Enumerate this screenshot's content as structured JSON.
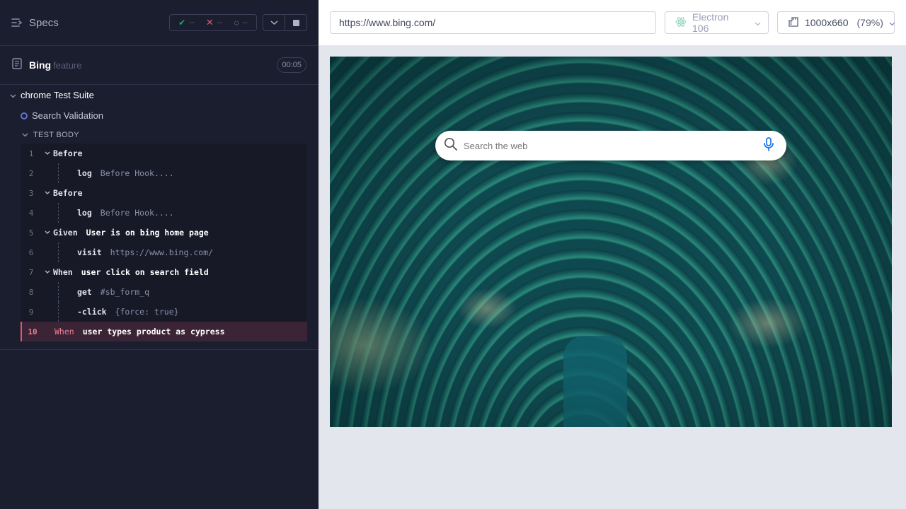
{
  "sidebar": {
    "title": "Specs",
    "stats": {
      "passed": "--",
      "failed": "--",
      "pending": "--"
    },
    "file": {
      "name": "Bing",
      "ext": "feature",
      "duration": "00:05"
    },
    "suite": "chrome Test Suite",
    "test": "Search Validation",
    "body_label": "TEST BODY",
    "commands": [
      {
        "num": "1",
        "kw": "Before",
        "msg": "",
        "arg": ""
      },
      {
        "num": "2",
        "kw": "log",
        "msg": "",
        "arg": "Before Hook...."
      },
      {
        "num": "3",
        "kw": "Before",
        "msg": "",
        "arg": ""
      },
      {
        "num": "4",
        "kw": "log",
        "msg": "",
        "arg": "Before Hook...."
      },
      {
        "num": "5",
        "kw": "Given",
        "msg": "User is on bing home page",
        "arg": ""
      },
      {
        "num": "6",
        "kw": "visit",
        "msg": "",
        "arg": "https://www.bing.com/"
      },
      {
        "num": "7",
        "kw": "When",
        "msg": "user click on search field",
        "arg": ""
      },
      {
        "num": "8",
        "kw": "get",
        "msg": "",
        "arg": "#sb_form_q"
      },
      {
        "num": "9",
        "kw": "-click",
        "msg": "",
        "arg": "{force: true}"
      },
      {
        "num": "10",
        "kw": "When",
        "msg": "user types product as cypress",
        "arg": ""
      }
    ]
  },
  "toolbar": {
    "url": "https://www.bing.com/",
    "browser": "Electron 106",
    "viewport": "1000x660",
    "zoom": "(79%)"
  },
  "aut": {
    "search_placeholder": "Search the web"
  },
  "colors": {
    "pass": "#1fa971",
    "fail": "#e45770",
    "accent": "#6470d3",
    "bing_blue": "#1a73e8"
  }
}
